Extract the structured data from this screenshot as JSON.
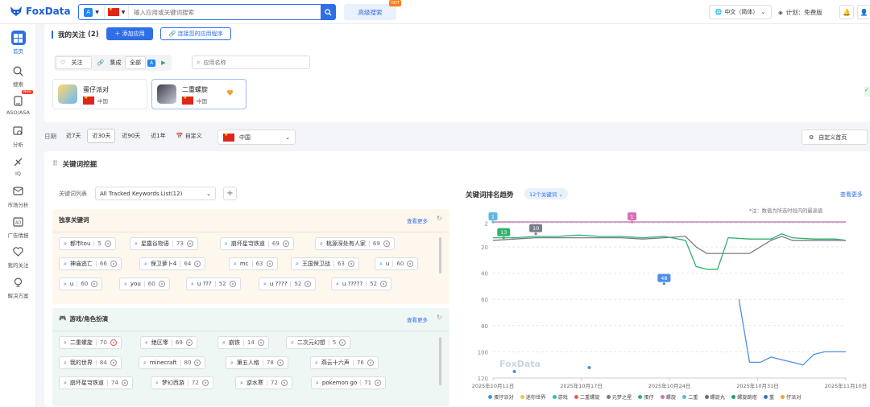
{
  "topbar": {
    "brand": "FoxData",
    "search_placeholder": "输入应用或关键词搜索",
    "advanced_search": "高级搜索",
    "hot_badge": "HOT",
    "language": "中文（简体）",
    "plan": "计划：免费版"
  },
  "sidebar": {
    "items": [
      {
        "label": "首页",
        "icon": "dashboard-icon"
      },
      {
        "label": "搜索",
        "icon": "search-icon"
      },
      {
        "label": "ASO/ASA",
        "icon": "aso-icon",
        "badge": "New"
      },
      {
        "label": "分析",
        "icon": "analysis-icon"
      },
      {
        "label": "IQ",
        "icon": "iq-icon"
      },
      {
        "label": "市场分析",
        "icon": "market-icon"
      },
      {
        "label": "广告情报",
        "icon": "ad-icon"
      },
      {
        "label": "我的关注",
        "icon": "heart-icon"
      },
      {
        "label": "解决方案",
        "icon": "bulb-icon"
      }
    ]
  },
  "follow": {
    "title": "我的关注",
    "count": "(2)",
    "add_app": "添加应用",
    "connect_app": "连接您的应用程序",
    "tabs": [
      "关注",
      "集成"
    ],
    "filters": [
      "全部"
    ],
    "name_placeholder": "应用名称",
    "apps": [
      {
        "name": "蛋仔派对",
        "country": "中国"
      },
      {
        "name": "二重螺旋",
        "country": "中国"
      }
    ]
  },
  "date": {
    "label": "日期",
    "ranges": [
      "近7天",
      "近30天",
      "近90天",
      "近1年",
      "自定义"
    ],
    "active": "近30天",
    "country": "中国",
    "custom_home": "自定义首页"
  },
  "keywords": {
    "section_title": "关键词挖掘",
    "list_label": "关键词列表",
    "list_value": "All Tracked Keywords List(12)",
    "groups": [
      {
        "title": "独享关键词",
        "more": "查看更多",
        "items": [
          {
            "kw": "都市tou",
            "rank": "5"
          },
          {
            "kw": "星露谷物语",
            "rank": "73"
          },
          {
            "kw": "崩坏星穹铁道",
            "rank": "69"
          },
          {
            "kw": "桃源深处有人家",
            "rank": "69"
          },
          {
            "kw": "神庙逃亡",
            "rank": "66"
          },
          {
            "kw": "保卫萝卜4",
            "rank": "64"
          },
          {
            "kw": "mc",
            "rank": "63"
          },
          {
            "kw": "王国保卫战",
            "rank": "63"
          },
          {
            "kw": "u",
            "rank": "60"
          },
          {
            "kw": "u",
            "rank": "60"
          },
          {
            "kw": "you",
            "rank": "60"
          },
          {
            "kw": "u ???",
            "rank": "52"
          },
          {
            "kw": "u ????",
            "rank": "52"
          },
          {
            "kw": "u ?????",
            "rank": "52"
          }
        ]
      },
      {
        "title": "游戏/角色扮演",
        "more": "查看更多",
        "items": [
          {
            "kw": "二重螺旋",
            "rank": "70"
          },
          {
            "kw": "绝区零",
            "rank": "69"
          },
          {
            "kw": "崩铁",
            "rank": "14"
          },
          {
            "kw": "二次元幻想",
            "rank": "5"
          },
          {
            "kw": "我的世界",
            "rank": "84"
          },
          {
            "kw": "minecraft",
            "rank": "80"
          },
          {
            "kw": "第五人格",
            "rank": "78"
          },
          {
            "kw": "燕云十六声",
            "rank": "76"
          },
          {
            "kw": "崩坏星穹铁道",
            "rank": "74"
          },
          {
            "kw": "梦幻西游",
            "rank": "72"
          },
          {
            "kw": "逆水寒",
            "rank": "72"
          },
          {
            "kw": "pokemon go",
            "rank": "71"
          }
        ]
      }
    ]
  },
  "trend": {
    "title": "关键词排名趋势",
    "chip": "12个关键词",
    "more": "查看更多",
    "note": "*注：数值为所选时段内的最高值",
    "watermark": "FoxData"
  },
  "chart_data": {
    "type": "line",
    "x_ticks": [
      "2025年10月11日",
      "2025年10月17日",
      "2025年10月24日",
      "2025年10月31日",
      "2025年11月10日"
    ],
    "y_ticks": [
      "2",
      "20",
      "40",
      "60",
      "80",
      "100",
      "120"
    ],
    "ylim": [
      120,
      1
    ],
    "series": [
      {
        "name": "蛋仔派对",
        "color": "#4a8fe7",
        "points": [
          [
            0,
            null
          ],
          [
            1,
            null
          ],
          [
            2,
            null
          ],
          [
            3,
            null
          ],
          [
            4,
            null
          ],
          [
            5,
            null
          ],
          [
            6,
            null
          ],
          [
            7,
            null
          ],
          [
            8,
            null
          ],
          [
            9,
            null
          ],
          [
            10,
            null
          ],
          [
            11,
            null
          ],
          [
            12,
            null
          ],
          [
            13,
            null
          ],
          [
            14,
            null
          ],
          [
            15,
            null
          ],
          [
            16,
            null
          ],
          [
            17,
            null
          ],
          [
            18,
            null
          ],
          [
            19,
            null
          ],
          [
            20,
            null
          ],
          [
            21,
            48
          ],
          [
            22,
            null
          ],
          [
            23,
            60
          ],
          [
            24,
            108
          ],
          [
            25,
            108
          ],
          [
            26,
            104
          ],
          [
            27,
            106
          ],
          [
            28,
            108
          ],
          [
            29,
            110
          ],
          [
            30,
            102
          ],
          [
            31,
            100
          ],
          [
            32,
            100
          ],
          [
            33,
            100
          ]
        ]
      },
      {
        "name": "游戏",
        "color": "#27c7a7",
        "points": [
          [
            0,
            1
          ],
          [
            33,
            1
          ]
        ]
      },
      {
        "name": "二重螺旋",
        "color": "#2fb26b",
        "points": [
          [
            0,
            13
          ],
          [
            2,
            13
          ],
          [
            4,
            12
          ],
          [
            6,
            12
          ],
          [
            8,
            11
          ],
          [
            10,
            12
          ],
          [
            12,
            12
          ],
          [
            14,
            13
          ],
          [
            16,
            12
          ],
          [
            18,
            15
          ],
          [
            19,
            35
          ],
          [
            20,
            37
          ],
          [
            21,
            37
          ],
          [
            22,
            13
          ],
          [
            24,
            14
          ],
          [
            26,
            14
          ],
          [
            27,
            10
          ],
          [
            28,
            13
          ],
          [
            30,
            14
          ],
          [
            32,
            14
          ],
          [
            33,
            15
          ]
        ]
      },
      {
        "name": "元梦之星",
        "color": "#7a7a8a",
        "points": [
          [
            0,
            15
          ],
          [
            2,
            14
          ],
          [
            4,
            13
          ],
          [
            6,
            13
          ],
          [
            8,
            13
          ],
          [
            10,
            13
          ],
          [
            12,
            13
          ],
          [
            14,
            14
          ],
          [
            16,
            13
          ],
          [
            18,
            12
          ],
          [
            19,
            20
          ],
          [
            20,
            25
          ],
          [
            21,
            25
          ],
          [
            22,
            25
          ],
          [
            24,
            25
          ],
          [
            26,
            15
          ],
          [
            27,
            12
          ],
          [
            28,
            15
          ],
          [
            30,
            15
          ],
          [
            32,
            15
          ],
          [
            33,
            15
          ]
        ]
      },
      {
        "name": "螺旋",
        "color": "#d86fb3",
        "points": [
          [
            0,
            1
          ],
          [
            33,
            1
          ]
        ]
      }
    ],
    "scatter": [
      {
        "x": 2,
        "y": 115,
        "color": "#4a8fe7"
      },
      {
        "x": 9,
        "y": 112,
        "color": "#4a8fe7"
      }
    ],
    "markers": [
      {
        "label": "1",
        "x": 0,
        "y": 1,
        "color": "#5fb7e0"
      },
      {
        "label": "13",
        "x": 1,
        "y": 13,
        "color": "#2fb26b"
      },
      {
        "label": "10",
        "x": 4,
        "y": 10,
        "color": "#7a7a8a"
      },
      {
        "label": "1",
        "x": 13,
        "y": 1,
        "color": "#d86fb3"
      },
      {
        "label": "48",
        "x": 16,
        "y": 48,
        "color": "#4a8fe7"
      }
    ],
    "legend": [
      {
        "name": "蛋仔派对",
        "color": "#4a8fe7"
      },
      {
        "name": "迷你世界",
        "color": "#f2c14e"
      },
      {
        "name": "游戏",
        "color": "#27c7a7"
      },
      {
        "name": "二重螺旋",
        "color": "#e85d4a"
      },
      {
        "name": "元梦之星",
        "color": "#7a7a8a"
      },
      {
        "name": "蛋仔",
        "color": "#2fb26b"
      },
      {
        "name": "螺旋",
        "color": "#d86fb3"
      },
      {
        "name": "二重",
        "color": "#5fb7e0"
      },
      {
        "name": "螺旋丸",
        "color": "#6b6b6b"
      },
      {
        "name": "螺旋跳塔",
        "color": "#21a05d"
      },
      {
        "name": "重",
        "color": "#3d6fd6"
      },
      {
        "name": "仔派对",
        "color": "#f0a33a"
      }
    ]
  }
}
